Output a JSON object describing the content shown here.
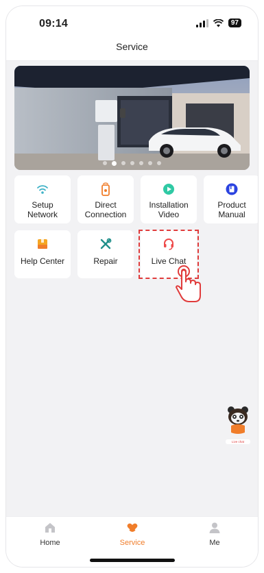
{
  "status_bar": {
    "time": "09:14",
    "battery": "97"
  },
  "header": {
    "title": "Service"
  },
  "banner": {
    "slides": 7,
    "active_index": 1
  },
  "services": [
    {
      "label": "Setup\nNetwork",
      "icon": "wifi-icon",
      "color": "#3fb2c7"
    },
    {
      "label": "Direct\nConnection",
      "icon": "remote-icon",
      "color": "#f07d2a"
    },
    {
      "label": "Installation\nVideo",
      "icon": "play-icon",
      "color": "#2fc9a4"
    },
    {
      "label": "Product\nManual",
      "icon": "manual-icon",
      "color": "#2b43e0"
    },
    {
      "label": "Help Center",
      "icon": "help-box-icon",
      "color": "#f5a623"
    },
    {
      "label": "Repair",
      "icon": "tools-icon",
      "color": "#1f8f8a"
    },
    {
      "label": "Live Chat",
      "icon": "headset-icon",
      "color": "#ee4a4a"
    }
  ],
  "floating_widget": {
    "label": "Live chat"
  },
  "tabbar": {
    "items": [
      {
        "label": "Home",
        "icon": "home-icon",
        "active": false
      },
      {
        "label": "Service",
        "icon": "service-heart-icon",
        "active": true
      },
      {
        "label": "Me",
        "icon": "person-icon",
        "active": false
      }
    ]
  },
  "colors": {
    "accent": "#f07d2a",
    "highlight": "#e03b3b",
    "background": "#f2f2f4"
  }
}
